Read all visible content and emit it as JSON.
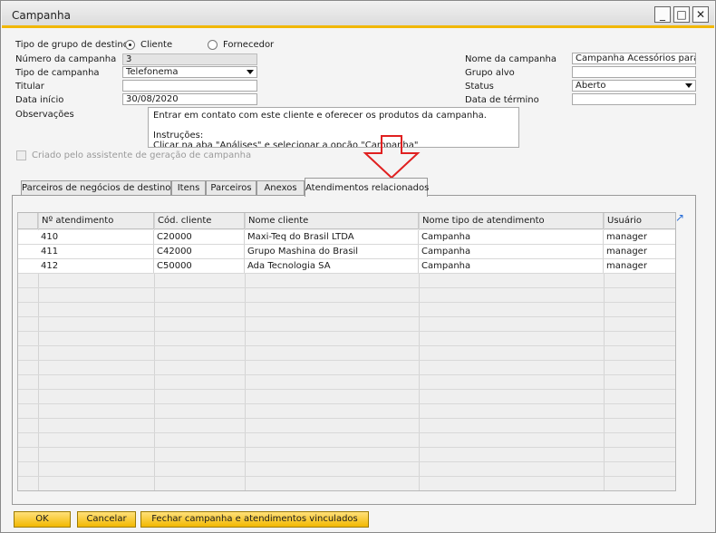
{
  "window": {
    "title": "Campanha",
    "minimize_glyph": "_",
    "maximize_glyph": "□",
    "close_glyph": "✕"
  },
  "form": {
    "target_group_type": {
      "label": "Tipo de grupo de destino",
      "options": [
        "Cliente",
        "Fornecedor"
      ],
      "selected": "Cliente"
    },
    "campaign_number": {
      "label": "Número da campanha",
      "value": "3"
    },
    "campaign_type": {
      "label": "Tipo de campanha",
      "value": "Telefonema"
    },
    "holder": {
      "label": "Titular",
      "value": ""
    },
    "start_date": {
      "label": "Data início",
      "value": "30/08/2020"
    },
    "observations": {
      "label": "Observações",
      "lines": [
        "Entrar em contato com este cliente e oferecer os produtos da campanha.",
        "",
        "Instruções:",
        "Clicar na aba \"Análises\" e selecionar a opção \"Campanha\""
      ]
    },
    "campaign_name": {
      "label": "Nome da campanha",
      "value": "Campanha Acessórios para Di"
    },
    "target_group": {
      "label": "Grupo alvo",
      "value": ""
    },
    "status": {
      "label": "Status",
      "value": "Aberto"
    },
    "end_date": {
      "label": "Data de término",
      "value": ""
    },
    "created_by_wizard": {
      "label": "Criado pelo assistente de geração de campanha",
      "checked": false
    }
  },
  "tabs": [
    {
      "label": "Parceiros de negócios de destino",
      "active": false
    },
    {
      "label": "Itens",
      "active": false
    },
    {
      "label": "Parceiros",
      "active": false
    },
    {
      "label": "Anexos",
      "active": false
    },
    {
      "label": "Atendimentos relacionados",
      "active": true
    }
  ],
  "grid": {
    "columns": [
      "",
      "Nº atendimento",
      "Cód. cliente",
      "Nome cliente",
      "Nome tipo de atendimento",
      "Usuário"
    ],
    "rows": [
      [
        "",
        "410",
        "C20000",
        "Maxi-Teq do Brasil LTDA",
        "Campanha",
        "manager"
      ],
      [
        "",
        "411",
        "C42000",
        "Grupo Mashina do Brasil",
        "Campanha",
        "manager"
      ],
      [
        "",
        "412",
        "C50000",
        "Ada Tecnologia SA",
        "Campanha",
        "manager"
      ]
    ],
    "expand_icon": "expand-icon",
    "expand_glyph": "↗"
  },
  "buttons": {
    "ok": "OK",
    "cancel": "Cancelar",
    "close_campaign": "Fechar campanha e atendimentos vinculados"
  },
  "annotation": {
    "arrow_color": "#e02020"
  },
  "colors": {
    "accent": "#f1b700",
    "button_fill": "#f2b800"
  }
}
